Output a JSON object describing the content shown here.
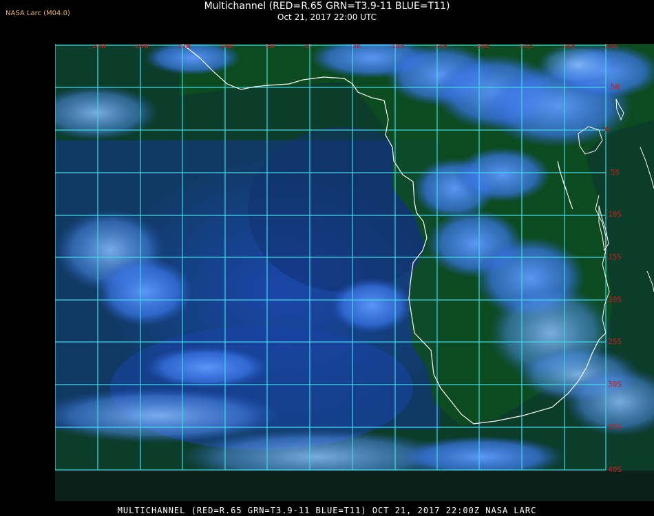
{
  "header": {
    "organization": "NASA Larc (M04.0)",
    "title": "Multichannel (RED=R.65 GRN=T3.9-11 BLUE=T11)",
    "subtitle": "Oct 21, 2017 22:00 UTC"
  },
  "footer": {
    "caption": "MULTICHANNEL (RED=R.65 GRN=T3.9-11 BLUE=T11) OCT 21, 2017 22:00Z  NASA LARC"
  },
  "map": {
    "longitude_labels": [
      "25W",
      "20W",
      "15W",
      "10W",
      "5W",
      "0",
      "5E",
      "10E",
      "15E",
      "20E",
      "25E",
      "30E",
      "35E"
    ],
    "latitude_labels": [
      "5N",
      "0",
      "5S",
      "10S",
      "15S",
      "20S",
      "25S",
      "30S",
      "35S",
      "40S"
    ],
    "colors": {
      "grid": "#3fd8e6",
      "grid_label": "#c81e1e",
      "coastline": "#ffffff",
      "ocean": "#0d2e66",
      "land": "#0c4a1c",
      "cloud": "#3a7cf0"
    }
  }
}
